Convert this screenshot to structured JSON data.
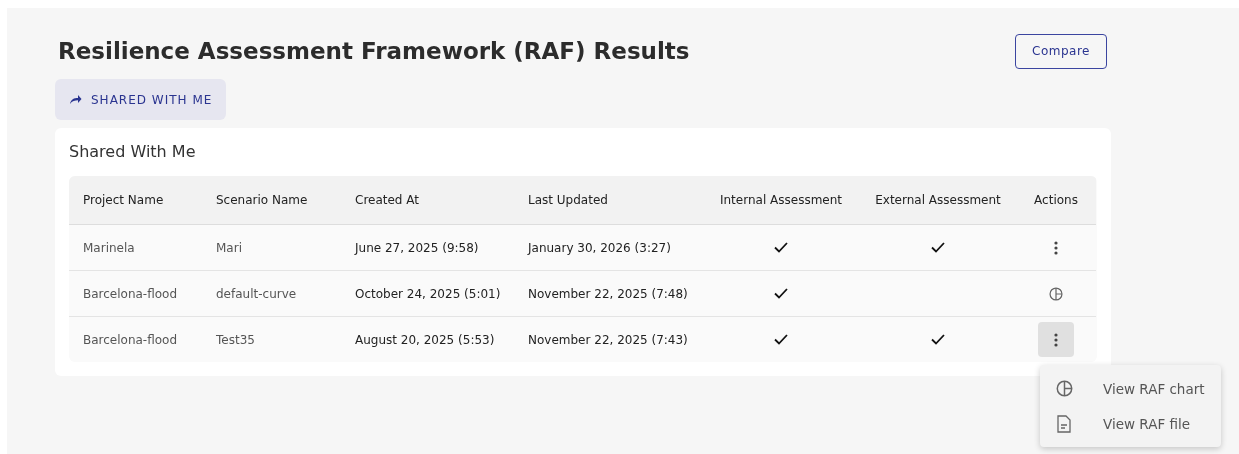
{
  "title": "Resilience Assessment Framework (RAF) Results",
  "compare_button": "Compare",
  "tabs": [
    {
      "label": "SHARED WITH ME",
      "selected": true
    }
  ],
  "card": {
    "title": "Shared With Me",
    "table": {
      "columns": [
        "Project Name",
        "Scenario Name",
        "Created At",
        "Last Updated",
        "Internal Assessment",
        "External Assessment",
        "Actions"
      ],
      "rows": [
        {
          "project": "Marinela",
          "scenario": "Mari",
          "created": "June 27, 2025 (9:58)",
          "updated": "January 30, 2026 (3:27)",
          "internal": true,
          "external": true,
          "action": {
            "kind": "menu",
            "active": false
          }
        },
        {
          "project": "Barcelona-flood",
          "scenario": "default-curve",
          "created": "October 24, 2025 (5:01)",
          "updated": "November 22, 2025 (7:48)",
          "internal": true,
          "external": false,
          "action": {
            "kind": "chart",
            "active": false
          }
        },
        {
          "project": "Barcelona-flood",
          "scenario": "Test35",
          "created": "August 20, 2025 (5:53)",
          "updated": "November 22, 2025 (7:43)",
          "internal": true,
          "external": true,
          "action": {
            "kind": "menu",
            "active": true
          }
        }
      ]
    }
  },
  "menu": {
    "items": [
      {
        "kind": "chart",
        "label": "View RAF chart"
      },
      {
        "kind": "file",
        "label": "View RAF file"
      }
    ]
  }
}
